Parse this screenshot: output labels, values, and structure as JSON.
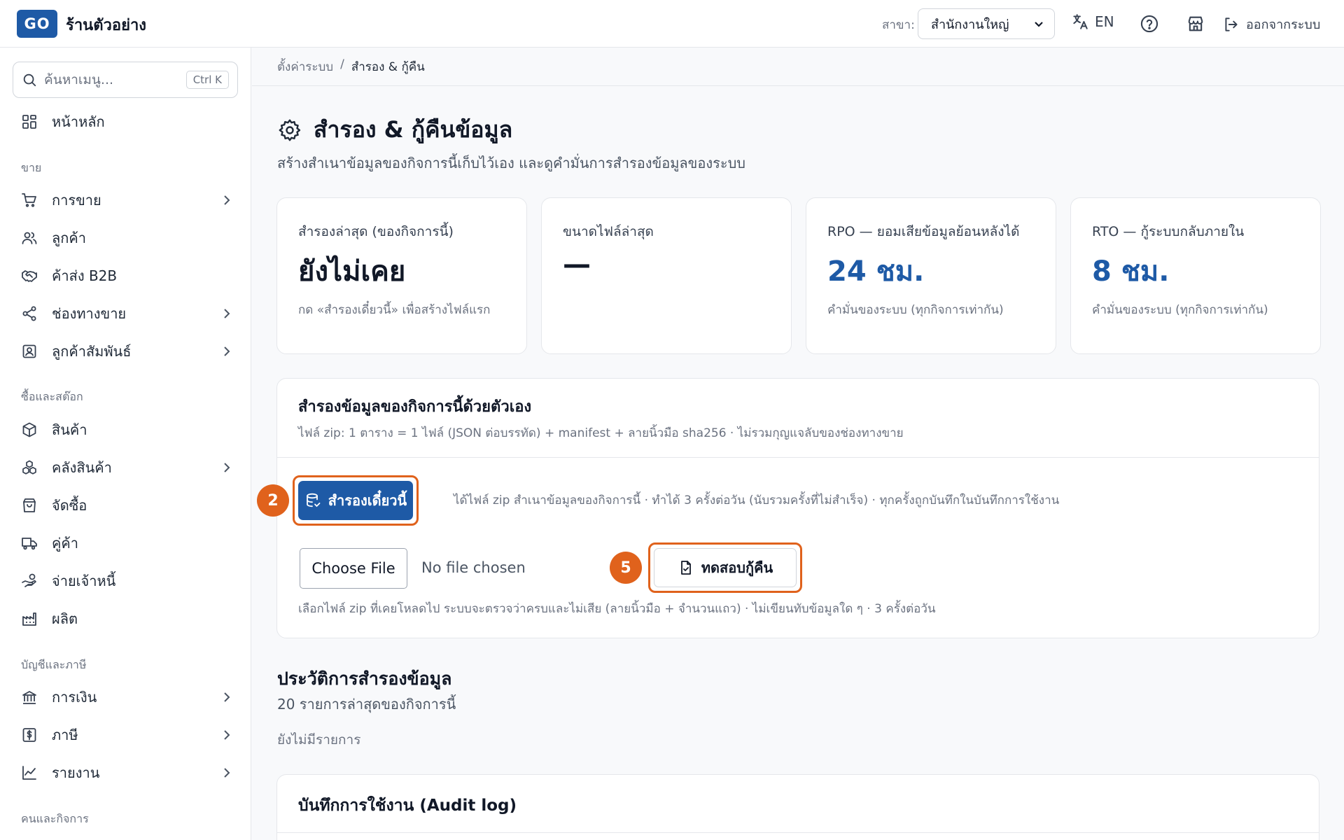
{
  "header": {
    "logo_text": "GO",
    "store_name": "ร้านตัวอย่าง",
    "branch_label": "สาขา:",
    "branch_value": "สำนักงานใหญ่",
    "lang_label": "EN",
    "logout_label": "ออกจากระบบ"
  },
  "sidebar": {
    "search_placeholder": "ค้นหาเมนู...",
    "search_shortcut": "Ctrl K",
    "home": "หน้าหลัก",
    "sections": {
      "sales": "ขาย",
      "purchasing": "ซื้อและสต๊อก",
      "accounting": "บัญชีและภาษี",
      "people": "คนและกิจการ"
    },
    "items": {
      "sales": "การขาย",
      "customers": "ลูกค้า",
      "b2b": "ค้าส่ง B2B",
      "channels": "ช่องทางขาย",
      "crm": "ลูกค้าสัมพันธ์",
      "products": "สินค้า",
      "warehouse": "คลังสินค้า",
      "procurement": "จัดซื้อ",
      "partners": "คู่ค้า",
      "payables": "จ่ายเจ้าหนี้",
      "production": "ผลิต",
      "finance": "การเงิน",
      "tax": "ภาษี",
      "reports": "รายงาน"
    }
  },
  "breadcrumb": {
    "parent": "ตั้งค่าระบบ",
    "separator": "/",
    "current": "สำรอง & กู้คืน"
  },
  "page": {
    "title": "สำรอง & กู้คืนข้อมูล",
    "subtitle": "สร้างสำเนาข้อมูลของกิจการนี้เก็บไว้เอง และดูคำมั่นการสำรองข้อมูลของระบบ"
  },
  "cards": [
    {
      "label": "สำรองล่าสุด (ของกิจการนี้)",
      "value": "ยังไม่เคย",
      "note": "กด «สำรองเดี๋ยวนี้» เพื่อสร้างไฟล์แรก"
    },
    {
      "label": "ขนาดไฟล์ล่าสุด",
      "value": "—",
      "note": ""
    },
    {
      "label": "RPO — ยอมเสียข้อมูลย้อนหลังได้",
      "value": "24 ชม.",
      "note": "คำมั่นของระบบ (ทุกกิจการเท่ากัน)"
    },
    {
      "label": "RTO — กู้ระบบกลับภายใน",
      "value": "8 ชม.",
      "note": "คำมั่นของระบบ (ทุกกิจการเท่ากัน)"
    }
  ],
  "manual_backup": {
    "title": "สำรองข้อมูลของกิจการนี้ด้วยตัวเอง",
    "subtitle": "ไฟล์ zip: 1 ตาราง = 1 ไฟล์ (JSON ต่อบรรทัด) + manifest + ลายนิ้วมือ sha256 · ไม่รวมกุญแจลับของช่องทางขาย",
    "backup_button": "สำรองเดี๋ยวนี้",
    "backup_help": "ได้ไฟล์ zip สำเนาข้อมูลของกิจการนี้ · ทำได้ 3 ครั้งต่อวัน (นับรวมครั้งที่ไม่สำเร็จ) · ทุกครั้งถูกบันทึกในบันทึกการใช้งาน",
    "step_backup": "2",
    "choose_file": "Choose File",
    "file_status": "No file chosen",
    "restore_button": "ทดสอบกู้คืน",
    "step_restore": "5",
    "restore_help": "เลือกไฟล์ zip ที่เคยโหลดไป ระบบจะตรวจว่าครบและไม่เสีย (ลายนิ้วมือ + จำนวนแถว) · ไม่เขียนทับข้อมูลใด ๆ · 3 ครั้งต่อวัน"
  },
  "history": {
    "title": "ประวัติการสำรองข้อมูล",
    "subtitle": "20 รายการล่าสุดของกิจการนี้",
    "empty": "ยังไม่มีรายการ"
  },
  "audit": {
    "title": "บันทึกการใช้งาน (Audit log)"
  },
  "colors": {
    "brand": "#1e5aa6",
    "highlight": "#e0621c"
  }
}
